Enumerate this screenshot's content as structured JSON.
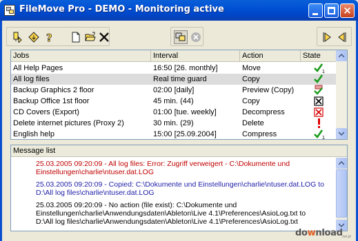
{
  "window": {
    "title": "FileMove Pro - DEMO - Monitoring activ",
    "title_emphasis": "e"
  },
  "toolbar": {
    "buttons": [
      "exit-icon",
      "gear-icon",
      "help-icon",
      "new-document-icon",
      "open-folder-icon",
      "delete-icon",
      "monitor-icon",
      "stop-icon",
      "next-icon",
      "previous-icon"
    ]
  },
  "jobs": {
    "columns": [
      "Jobs",
      "Interval",
      "Action",
      "State"
    ],
    "rows": [
      {
        "job": "All Help Pages",
        "interval": "16:50 [26. monthly]",
        "action": "Move",
        "state": "check-1"
      },
      {
        "job": "All log files",
        "interval": "Real time guard",
        "action": "Copy",
        "state": "check"
      },
      {
        "job": "Backup Graphics 2 floor",
        "interval": "02:00 [daily]",
        "action": "Preview (Copy)",
        "state": "preview-check"
      },
      {
        "job": "Backup Office 1st floor",
        "interval": "45 min. (44)",
        "action": "Copy",
        "state": "box-x-black"
      },
      {
        "job": "CD Covers (Export)",
        "interval": "01:00 [tue. weekly]",
        "action": "Decompress",
        "state": "box-x-red"
      },
      {
        "job": "Delete internet pictures (Proxy 2)",
        "interval": "30 min. (29)",
        "action": "Delete",
        "state": "exclamation"
      },
      {
        "job": "English help",
        "interval": "15:00 [25.09.2004]",
        "action": "Compress",
        "state": "check-1"
      }
    ],
    "selected_index": 1
  },
  "messages": {
    "header": "Message list",
    "items": [
      {
        "color": "red",
        "line1": "25.03.2005 09:20:09 - All log files: Error: Zugriff verweigert - C:\\Dokumente und",
        "line2": "Einstellungen\\charlie\\ntuser.dat.LOG"
      },
      {
        "color": "blue",
        "line1": "25.03.2005 09:20:09 - Copied: C:\\Dokumente und Einstellungen\\charlie\\ntuser.dat.LOG to",
        "line2": "D:\\All log files\\charlie\\ntuser.dat.LOG"
      },
      {
        "color": "black",
        "line1": "25.03.2005 09:20:09 - No action (file exist): C:\\Dokumente und",
        "line2": "Einstellungen\\charlie\\Anwendungsdaten\\Ableton\\Live 4.1\\Preferences\\AsioLog.txt to",
        "line3": "D:\\All log files\\charlie\\Anwendungsdaten\\Ableton\\Live 4.1\\Preferences\\AsioLog.txt"
      }
    ]
  },
  "watermark": {
    "text_a": "do",
    "text_ring": "w",
    "text_b": "nload",
    "sub": ".net.pl"
  },
  "colors": {
    "titlebar": "#0051d4",
    "error": "#c00000",
    "info": "#1d1da8",
    "check": "#1a9a1a"
  }
}
